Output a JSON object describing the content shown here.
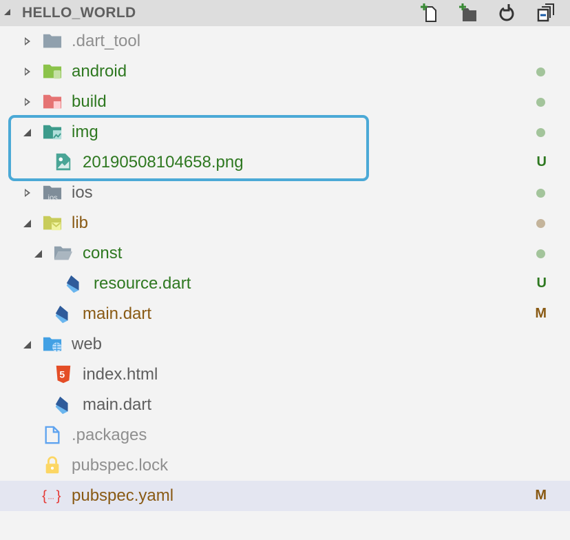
{
  "header": {
    "title": "HELLO_WORLD",
    "actions": [
      "new-file",
      "new-folder",
      "refresh",
      "collapse-all"
    ]
  },
  "colors": {
    "green": "#2e7820",
    "brown": "#895a14",
    "focus": "#4ba9d6"
  },
  "tree": [
    {
      "name": ".dart_tool",
      "depth": 0,
      "twisty": "closed",
      "icon": "folder-grey",
      "color": "grey",
      "badge": ""
    },
    {
      "name": "android",
      "depth": 0,
      "twisty": "closed",
      "icon": "folder-android",
      "color": "green",
      "badge": "dot"
    },
    {
      "name": "build",
      "depth": 0,
      "twisty": "closed",
      "icon": "folder-build",
      "color": "green",
      "badge": "dot"
    },
    {
      "name": "img",
      "depth": 0,
      "twisty": "open",
      "icon": "folder-images",
      "color": "green",
      "badge": "dot"
    },
    {
      "name": "20190508104658.png",
      "depth": 1,
      "twisty": "none",
      "icon": "image-file",
      "color": "green",
      "badge": "U"
    },
    {
      "name": "ios",
      "depth": 0,
      "twisty": "closed",
      "icon": "folder-ios",
      "color": "dark",
      "badge": "dot"
    },
    {
      "name": "lib",
      "depth": 0,
      "twisty": "open",
      "icon": "folder-lib",
      "color": "brown",
      "badge": "dot-brown"
    },
    {
      "name": "const",
      "depth": 1,
      "twisty": "open",
      "icon": "folder-open-grey",
      "color": "green",
      "badge": "dot"
    },
    {
      "name": "resource.dart",
      "depth": 2,
      "twisty": "none",
      "icon": "dart-file",
      "color": "green",
      "badge": "U"
    },
    {
      "name": "main.dart",
      "depth": 1,
      "twisty": "none",
      "icon": "dart-file",
      "color": "brown",
      "badge": "M"
    },
    {
      "name": "web",
      "depth": 0,
      "twisty": "open",
      "icon": "folder-web",
      "color": "dark",
      "badge": ""
    },
    {
      "name": "index.html",
      "depth": 1,
      "twisty": "none",
      "icon": "html-file",
      "color": "dark",
      "badge": ""
    },
    {
      "name": "main.dart",
      "depth": 1,
      "twisty": "none",
      "icon": "dart-file",
      "color": "dark",
      "badge": ""
    },
    {
      "name": ".packages",
      "depth": 0,
      "twisty": "none",
      "icon": "generic-file",
      "color": "grey",
      "badge": ""
    },
    {
      "name": "pubspec.lock",
      "depth": 0,
      "twisty": "none",
      "icon": "lock-file",
      "color": "grey",
      "badge": ""
    },
    {
      "name": "pubspec.yaml",
      "depth": 0,
      "twisty": "none",
      "icon": "yaml-file",
      "color": "brown",
      "badge": "M",
      "selected": true
    }
  ]
}
